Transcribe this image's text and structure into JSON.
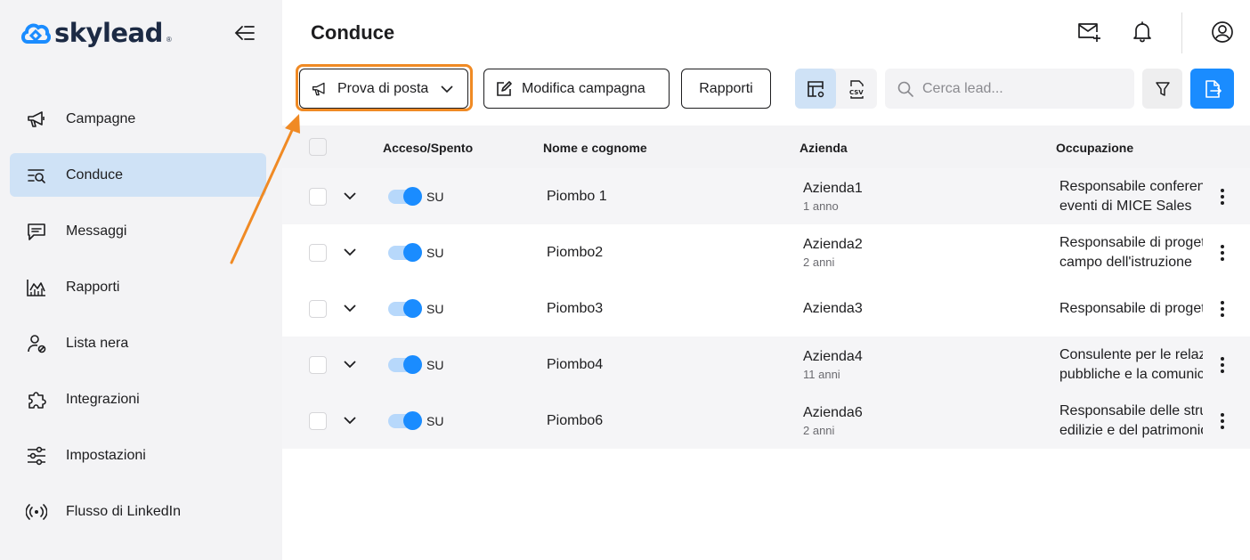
{
  "brand": {
    "name": "skylead",
    "reg": "®",
    "color": "#1a8cff"
  },
  "sidebar": {
    "items": [
      {
        "label": "Campagne",
        "icon": "megaphone-icon",
        "active": false
      },
      {
        "label": "Conduce",
        "icon": "leads-search-icon",
        "active": true
      },
      {
        "label": "Messaggi",
        "icon": "message-icon",
        "active": false
      },
      {
        "label": "Rapporti",
        "icon": "chart-icon",
        "active": false
      },
      {
        "label": "Lista nera",
        "icon": "user-block-icon",
        "active": false
      },
      {
        "label": "Integrazioni",
        "icon": "puzzle-icon",
        "active": false
      },
      {
        "label": "Impostazioni",
        "icon": "sliders-icon",
        "active": false
      },
      {
        "label": "Flusso di LinkedIn",
        "icon": "broadcast-icon",
        "active": false
      }
    ]
  },
  "header": {
    "title": "Conduce"
  },
  "toolbar": {
    "mail_test_label": "Prova di posta",
    "edit_campaign_label": "Modifica campagna",
    "reports_label": "Rapporti",
    "search_placeholder": "Cerca lead...",
    "highlight_color": "#f08a24"
  },
  "table": {
    "columns": [
      "Acceso/Spento",
      "Nome e cognome",
      "Azienda",
      "Occupazione"
    ],
    "rows": [
      {
        "status": "SU",
        "name": "Piombo 1",
        "company": "Azienda1",
        "years": "1 anno",
        "occupation": [
          "Responsabile conferenze ed",
          "eventi di MICE Sales"
        ]
      },
      {
        "status": "SU",
        "name": "Piombo2",
        "company": "Azienda2",
        "years": "2 anni",
        "occupation": [
          "Responsabile di progetti nel",
          "campo dell'istruzione"
        ]
      },
      {
        "status": "SU",
        "name": "Piombo3",
        "company": "Azienda3",
        "years": "",
        "occupation": [
          "Responsabile di progetti"
        ]
      },
      {
        "status": "SU",
        "name": "Piombo4",
        "company": "Azienda4",
        "years": "11 anni",
        "occupation": [
          "Consulente per le relazioni",
          "pubbliche e la comunicazione"
        ]
      },
      {
        "status": "SU",
        "name": "Piombo6",
        "company": "Azienda6",
        "years": "2 anni",
        "occupation": [
          "Responsabile delle strutture",
          "edilizie e del patrimonio"
        ]
      }
    ]
  }
}
